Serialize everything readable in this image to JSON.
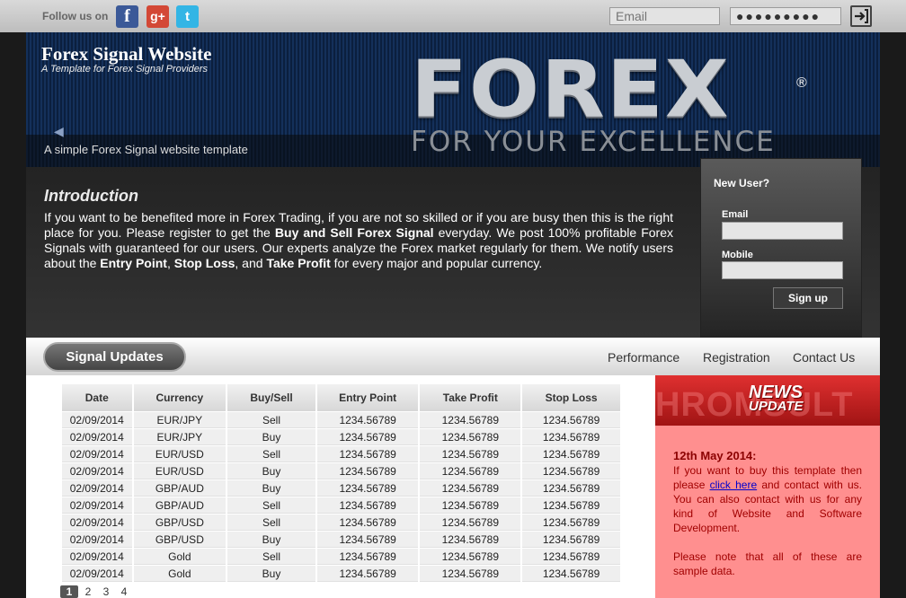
{
  "topbar": {
    "follow_label": "Follow us on",
    "social": [
      {
        "name": "facebook",
        "glyph": "f",
        "color": "#3b5998"
      },
      {
        "name": "google-plus",
        "glyph": "g+",
        "color": "#d34836"
      },
      {
        "name": "twitter",
        "glyph": "t",
        "color": "#33b5e5"
      }
    ],
    "email_placeholder": "Email",
    "password_value": "●●●●●●●●●"
  },
  "banner": {
    "title": "Forex Signal Website",
    "tagline": "A Template for Forex Signal Providers",
    "caption": "A simple Forex Signal website template",
    "logo_text": "FOREX",
    "logo_reg": "®",
    "slogan": "FOR YOUR EXCELLENCE"
  },
  "intro": {
    "title": "Introduction",
    "p1": "If you want to be benefited more in Forex Trading, if you are not so skilled or if you are busy then this is the right place for you. Please register to get the ",
    "b1": "Buy and Sell Forex Signal",
    "p2": " everyday. We post 100% profitable Forex Signals with guaranteed for our users. Our experts analyze the Forex market regularly for them. We notify users about the ",
    "b2": "Entry Point",
    "p3": ", ",
    "b3": "Stop Loss",
    "p4": ", and ",
    "b4": "Take Profit",
    "p5": " for every major and popular currency."
  },
  "newuser": {
    "title": "New User?",
    "email_label": "Email",
    "mobile_label": "Mobile",
    "signup_label": "Sign up"
  },
  "nav": {
    "active_tab": "Signal Updates",
    "links": [
      "Performance",
      "Registration",
      "Contact Us"
    ]
  },
  "table": {
    "headers": [
      "Date",
      "Currency",
      "Buy/Sell",
      "Entry Point",
      "Take Profit",
      "Stop Loss"
    ],
    "rows": [
      [
        "02/09/2014",
        "EUR/JPY",
        "Sell",
        "1234.56789",
        "1234.56789",
        "1234.56789"
      ],
      [
        "02/09/2014",
        "EUR/JPY",
        "Buy",
        "1234.56789",
        "1234.56789",
        "1234.56789"
      ],
      [
        "02/09/2014",
        "EUR/USD",
        "Sell",
        "1234.56789",
        "1234.56789",
        "1234.56789"
      ],
      [
        "02/09/2014",
        "EUR/USD",
        "Buy",
        "1234.56789",
        "1234.56789",
        "1234.56789"
      ],
      [
        "02/09/2014",
        "GBP/AUD",
        "Buy",
        "1234.56789",
        "1234.56789",
        "1234.56789"
      ],
      [
        "02/09/2014",
        "GBP/AUD",
        "Sell",
        "1234.56789",
        "1234.56789",
        "1234.56789"
      ],
      [
        "02/09/2014",
        "GBP/USD",
        "Sell",
        "1234.56789",
        "1234.56789",
        "1234.56789"
      ],
      [
        "02/09/2014",
        "GBP/USD",
        "Buy",
        "1234.56789",
        "1234.56789",
        "1234.56789"
      ],
      [
        "02/09/2014",
        "Gold",
        "Sell",
        "1234.56789",
        "1234.56789",
        "1234.56789"
      ],
      [
        "02/09/2014",
        "Gold",
        "Buy",
        "1234.56789",
        "1234.56789",
        "1234.56789"
      ]
    ],
    "pages": [
      "1",
      "2",
      "3",
      "4"
    ],
    "current_page": "1"
  },
  "news": {
    "badge_line1": "NEWS",
    "badge_line2": "UPDATE",
    "bg_text": "HROMSULT",
    "date": "12th May 2014:",
    "t1": "If you want to buy this template then please ",
    "link": "click here",
    "t2": " and contact with us. You can also contact with us for any kind of Website and Software Development.",
    "note": "Please note that all of these are sample data."
  },
  "colors": {
    "banner_blue": "#14305a",
    "news_red": "#ff8f8f",
    "news_text": "#a00000"
  }
}
